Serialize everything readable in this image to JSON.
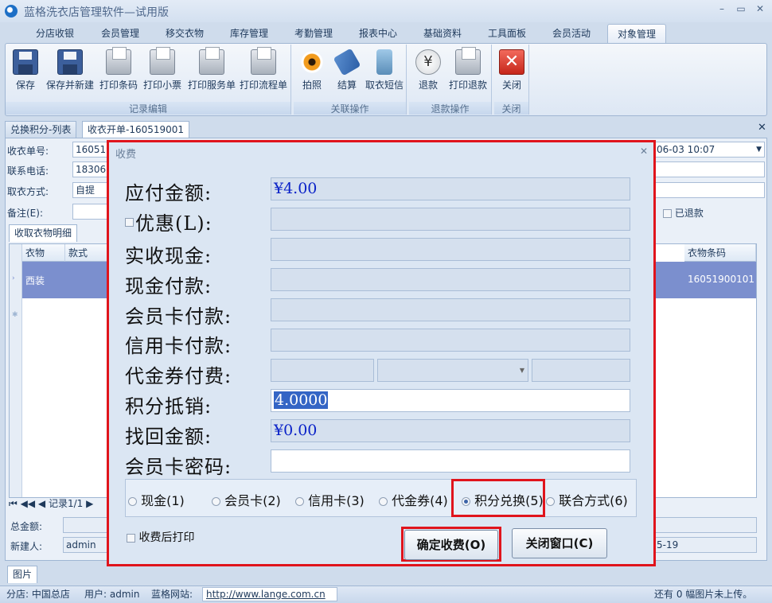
{
  "window": {
    "title": "蓝格洗衣店管理软件—试用版"
  },
  "menu_tabs": [
    "分店收银",
    "会员管理",
    "移交衣物",
    "库存管理",
    "考勤管理",
    "报表中心",
    "基础资料",
    "工具面板",
    "会员活动",
    "对象管理"
  ],
  "ribbon": {
    "groups": [
      {
        "label": "记录编辑",
        "buttons": [
          {
            "label": "保存",
            "icon": "save-icon"
          },
          {
            "label": "保存并新建",
            "icon": "save-new-icon"
          },
          {
            "label": "打印条码",
            "icon": "printer-icon"
          },
          {
            "label": "打印小票",
            "icon": "printer-icon"
          },
          {
            "label": "打印服务单",
            "icon": "printer-icon"
          },
          {
            "label": "打印流程单",
            "icon": "printer-icon"
          }
        ]
      },
      {
        "label": "关联操作",
        "buttons": [
          {
            "label": "拍照",
            "icon": "eye-icon"
          },
          {
            "label": "结算",
            "icon": "tag-icon"
          },
          {
            "label": "取衣短信",
            "icon": "phone-icon"
          }
        ]
      },
      {
        "label": "退款操作",
        "buttons": [
          {
            "label": "退款",
            "icon": "yen-icon"
          },
          {
            "label": "打印退款",
            "icon": "printer-icon"
          }
        ]
      },
      {
        "label": "关闭",
        "buttons": [
          {
            "label": "关闭",
            "icon": "close-icon"
          }
        ]
      }
    ]
  },
  "doc_tabs": [
    "兑换积分-列表",
    "收衣开单-160519001"
  ],
  "form": {
    "order_no_label": "收衣单号:",
    "order_no": "160519",
    "phone_label": "联系电话:",
    "phone": "183066",
    "pickup_label": "取衣方式:",
    "pickup": "自提",
    "note_label": "备注(E):",
    "datetime": "06-03 10:07",
    "refunded_label": "已退款",
    "detail_tab": "收取衣物明细",
    "grid_headers": {
      "col1": "衣物",
      "col2": "款式",
      "col_last": "衣物条码"
    },
    "grid_row": {
      "item": "西装",
      "barcode": "16051900101"
    },
    "pager": "记录1/1",
    "total_label": "总金额:",
    "creator_label": "新建人:",
    "creator": "admin",
    "date_tail": "5-19",
    "pics_tab": "图片"
  },
  "dialog": {
    "title": "收费",
    "amount_due_label": "应付金额:",
    "amount_due": "¥4.00",
    "discount_label": "优惠(L):",
    "cash_received_label": "实收现金:",
    "cash_pay_label": "现金付款:",
    "member_card_pay_label": "会员卡付款:",
    "credit_card_pay_label": "信用卡付款:",
    "voucher_pay_label": "代金券付费:",
    "points_label": "积分抵销:",
    "points": "4.0000",
    "change_label": "找回金额:",
    "change": "¥0.00",
    "card_password_label": "会员卡密码:",
    "pay_methods": [
      "现金(1)",
      "会员卡(2)",
      "信用卡(3)",
      "代金券(4)",
      "积分兑换(5)",
      "联合方式(6)"
    ],
    "selected_method": "积分兑换(5)",
    "print_after_label": "收费后打印",
    "confirm_label": "确定收费(O)",
    "close_label": "关闭窗口(C)"
  },
  "statusbar": {
    "branch": "分店: 中国总店",
    "user": "用户: admin",
    "site_label": "蓝格网站:",
    "site_url": "http://www.lange.com.cn",
    "pics_status": "还有 0 幅图片未上传。"
  }
}
